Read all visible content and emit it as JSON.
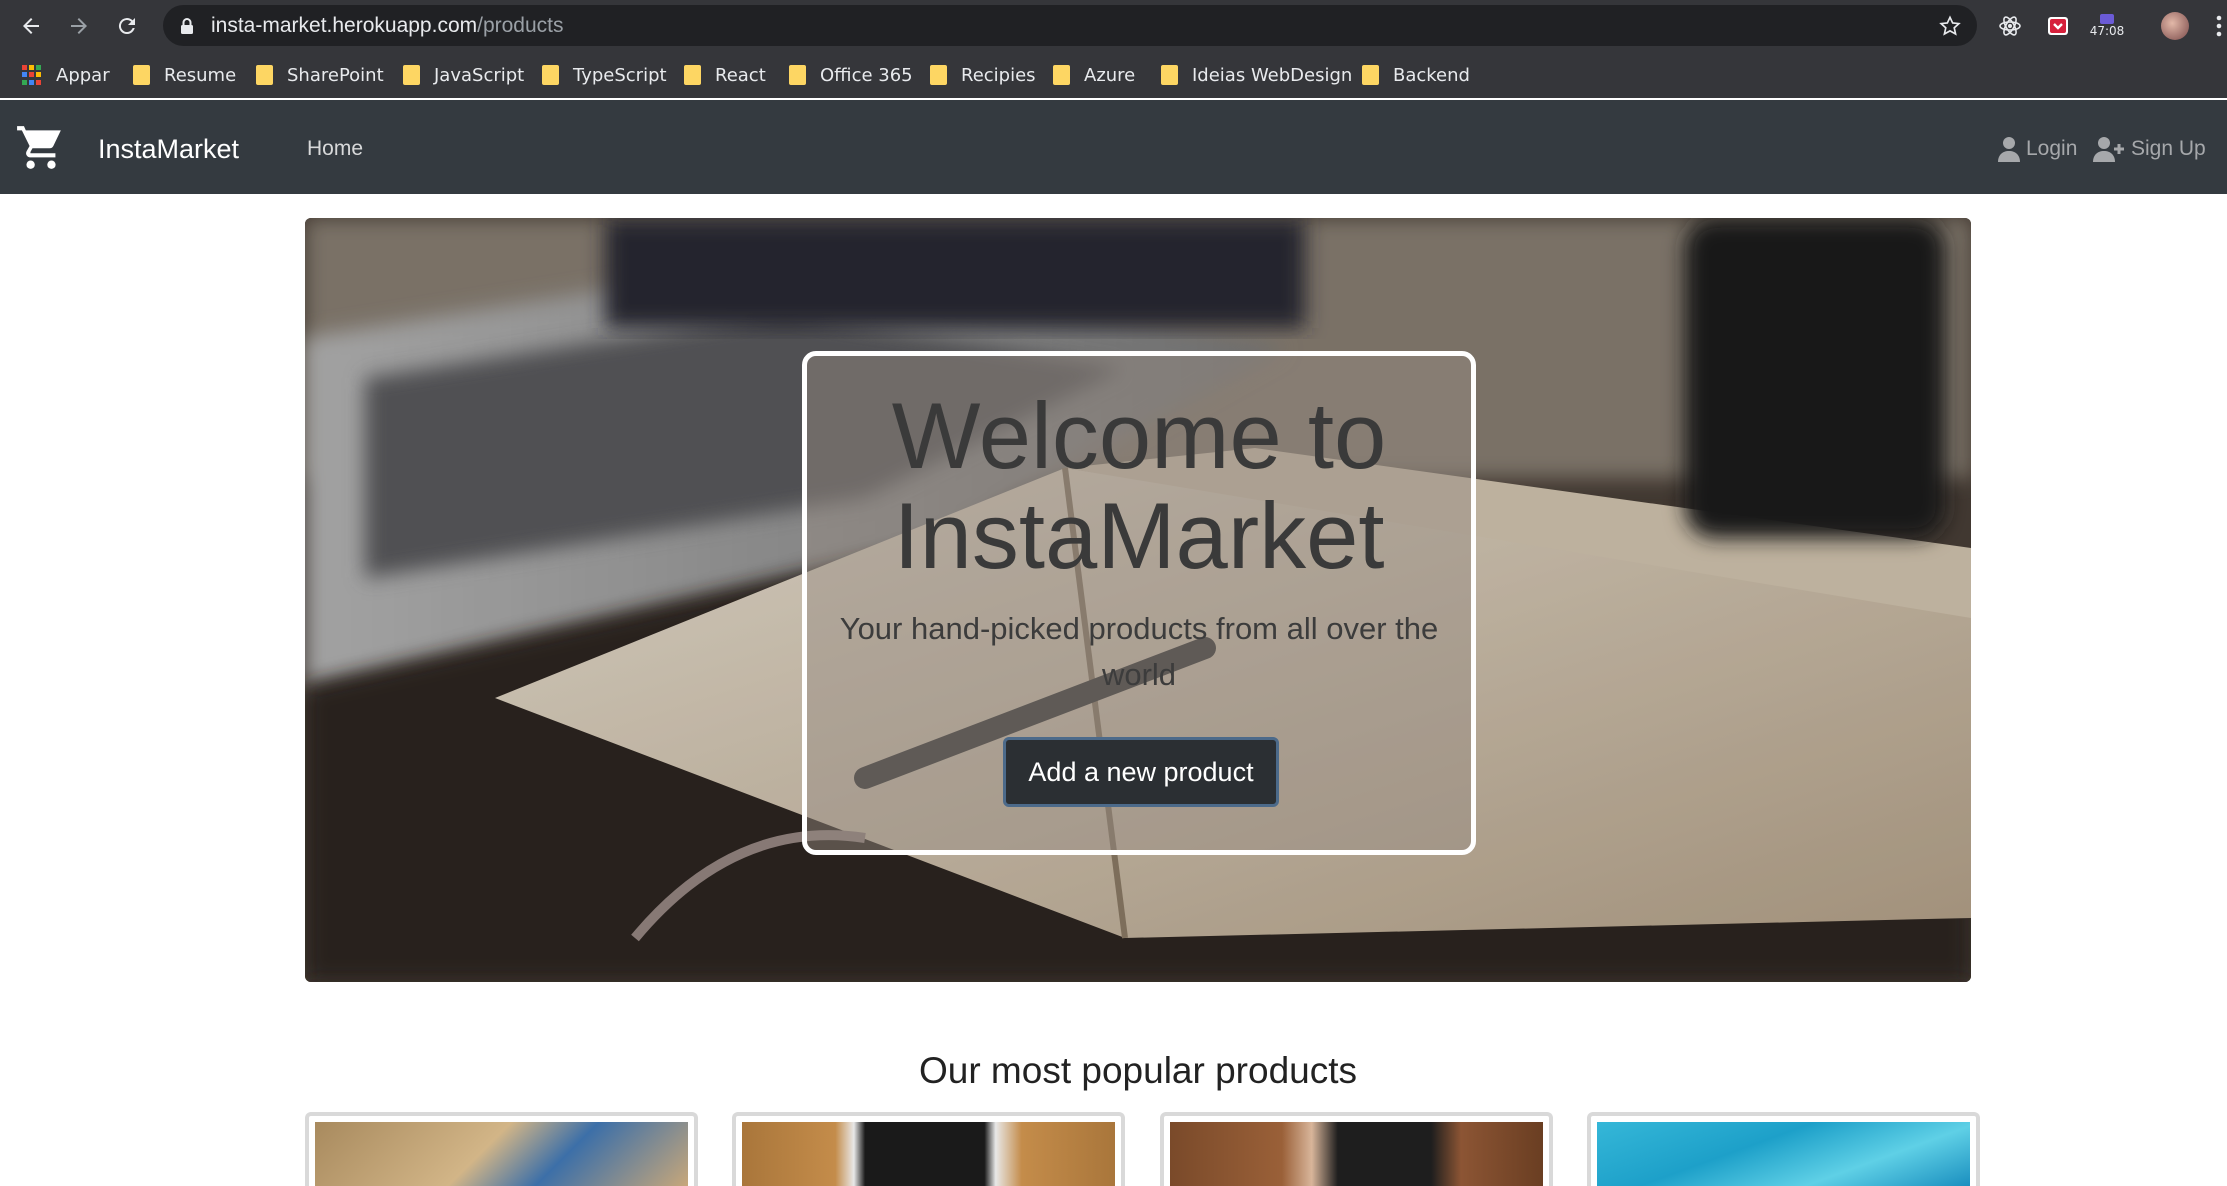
{
  "browser": {
    "url_host": "insta-market.herokuapp.com",
    "url_path": "/products",
    "extension_timer": "47:08",
    "bookmarks": [
      {
        "label": "Appar",
        "icon": "apps-grid-icon"
      },
      {
        "label": "Resume",
        "icon": "folder-icon"
      },
      {
        "label": "SharePoint",
        "icon": "folder-icon"
      },
      {
        "label": "JavaScript",
        "icon": "folder-icon"
      },
      {
        "label": "TypeScript",
        "icon": "folder-icon"
      },
      {
        "label": "React",
        "icon": "folder-icon"
      },
      {
        "label": "Office 365",
        "icon": "folder-icon"
      },
      {
        "label": "Recipies",
        "icon": "folder-icon"
      },
      {
        "label": "Azure",
        "icon": "folder-icon"
      },
      {
        "label": "Ideias WebDesign",
        "icon": "folder-icon"
      },
      {
        "label": "Backend",
        "icon": "folder-icon"
      }
    ]
  },
  "navbar": {
    "brand": "InstaMarket",
    "brand_icon": "shopping-cart-icon",
    "links": [
      {
        "label": "Home"
      }
    ],
    "login_label": "Login",
    "signup_label": "Sign Up"
  },
  "hero": {
    "title": "Welcome to InstaMarket",
    "subtitle": "Your hand-picked products from all over the world",
    "button_label": "Add a new product"
  },
  "popular": {
    "title": "Our most popular products",
    "products": [
      {
        "image": "phone-on-desk"
      },
      {
        "image": "laptop-on-wood"
      },
      {
        "image": "phone-in-hand"
      },
      {
        "image": "blue-water"
      }
    ]
  },
  "colors": {
    "navbar_bg": "#343a40",
    "chrome_bg": "#35363a",
    "omnibox_bg": "#202124",
    "folder": "#fdd663"
  }
}
